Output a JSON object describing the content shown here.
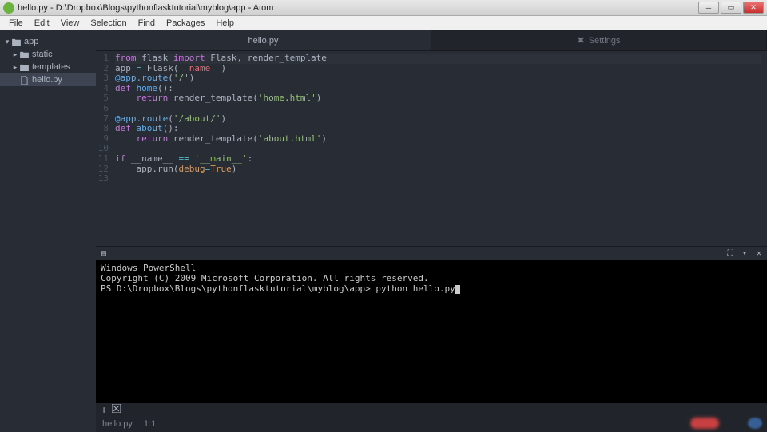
{
  "window": {
    "title": "hello.py - D:\\Dropbox\\Blogs\\pythonflasktutorial\\myblog\\app - Atom"
  },
  "menubar": [
    "File",
    "Edit",
    "View",
    "Selection",
    "Find",
    "Packages",
    "Help"
  ],
  "tree": {
    "root": "app",
    "items": [
      {
        "name": "static",
        "type": "folder"
      },
      {
        "name": "templates",
        "type": "folder"
      },
      {
        "name": "hello.py",
        "type": "file",
        "selected": true
      }
    ]
  },
  "tabs": [
    {
      "label": "hello.py",
      "active": true
    },
    {
      "label": "Settings",
      "active": false,
      "icon": "gear"
    }
  ],
  "code": {
    "lines": [
      {
        "n": 1,
        "tokens": [
          [
            "kw",
            "from"
          ],
          [
            "",
            " flask "
          ],
          [
            "kw",
            "import"
          ],
          [
            "",
            " Flask, render_template"
          ]
        ],
        "current": true
      },
      {
        "n": 2,
        "tokens": [
          [
            "",
            "app "
          ],
          [
            "op",
            "="
          ],
          [
            "",
            " Flask("
          ],
          [
            "var",
            "__name__"
          ],
          [
            "",
            ")"
          ]
        ]
      },
      {
        "n": 3,
        "tokens": [
          [
            "dec",
            "@app.route"
          ],
          [
            "",
            "("
          ],
          [
            "str",
            "'/'"
          ],
          [
            "",
            ")"
          ]
        ]
      },
      {
        "n": 4,
        "tokens": [
          [
            "kw",
            "def"
          ],
          [
            "",
            " "
          ],
          [
            "fn",
            "home"
          ],
          [
            "",
            "():"
          ]
        ]
      },
      {
        "n": 5,
        "tokens": [
          [
            "",
            "    "
          ],
          [
            "kw",
            "return"
          ],
          [
            "",
            " render_template("
          ],
          [
            "str",
            "'home.html'"
          ],
          [
            "",
            ")"
          ]
        ]
      },
      {
        "n": 6,
        "tokens": []
      },
      {
        "n": 7,
        "tokens": [
          [
            "dec",
            "@app.route"
          ],
          [
            "",
            "("
          ],
          [
            "str",
            "'/about/'"
          ],
          [
            "",
            ")"
          ]
        ]
      },
      {
        "n": 8,
        "tokens": [
          [
            "kw",
            "def"
          ],
          [
            "",
            " "
          ],
          [
            "fn",
            "about"
          ],
          [
            "",
            "():"
          ]
        ]
      },
      {
        "n": 9,
        "tokens": [
          [
            "",
            "    "
          ],
          [
            "kw",
            "return"
          ],
          [
            "",
            " render_template("
          ],
          [
            "str",
            "'about.html'"
          ],
          [
            "",
            ")"
          ]
        ]
      },
      {
        "n": 10,
        "tokens": []
      },
      {
        "n": 11,
        "tokens": [
          [
            "kw",
            "if"
          ],
          [
            "",
            " __name__ "
          ],
          [
            "op",
            "=="
          ],
          [
            "",
            " "
          ],
          [
            "str",
            "'__main__'"
          ],
          [
            "",
            ":"
          ]
        ]
      },
      {
        "n": 12,
        "tokens": [
          [
            "",
            "    app.run("
          ],
          [
            "sup",
            "debug"
          ],
          [
            "op",
            "="
          ],
          [
            "const",
            "True"
          ],
          [
            "",
            ")"
          ]
        ]
      },
      {
        "n": 13,
        "tokens": []
      }
    ]
  },
  "terminal": {
    "title": "Windows PowerShell",
    "lines": [
      "Windows PowerShell",
      "Copyright (C) 2009 Microsoft Corporation. All rights reserved.",
      "",
      "PS D:\\Dropbox\\Blogs\\pythonflasktutorial\\myblog\\app> python hello.py"
    ]
  },
  "status": {
    "file": "hello.py",
    "pos": "1:1"
  }
}
